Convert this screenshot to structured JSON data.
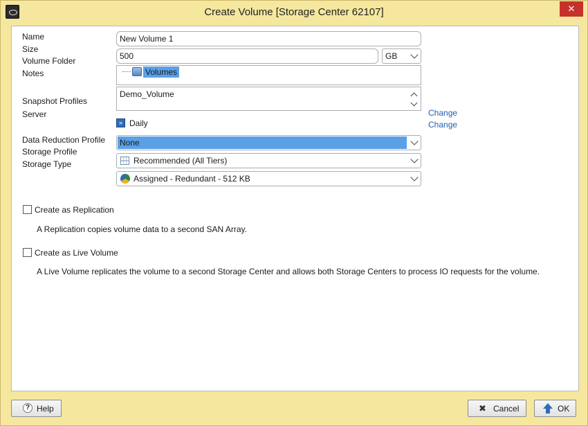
{
  "window": {
    "title": "Create Volume [Storage Center 62107]",
    "close_glyph": "✕"
  },
  "labels": {
    "name": "Name",
    "size": "Size",
    "volume_folder": "Volume Folder",
    "notes": "Notes",
    "snapshot_profiles": "Snapshot Profiles",
    "server": "Server",
    "data_reduction_profile": "Data Reduction Profile",
    "storage_profile": "Storage Profile",
    "storage_type": "Storage Type"
  },
  "fields": {
    "name_value": "New Volume 1",
    "size_value": "500",
    "size_unit": "GB",
    "volume_folder_value": "Volumes",
    "notes_value": "Demo_Volume",
    "snapshot_profile_value": "Daily",
    "data_reduction_value": "None",
    "storage_profile_value": "Recommended (All Tiers)",
    "storage_type_value": "Assigned - Redundant - 512 KB"
  },
  "links": {
    "change_snapshot": "Change",
    "change_server": "Change"
  },
  "replication": {
    "label": "Create as Replication",
    "description": "A Replication copies volume data to a second SAN Array."
  },
  "live_volume": {
    "label": "Create as Live Volume",
    "description": "A Live Volume replicates the volume to a second Storage Center and allows both Storage Centers to process IO requests for the volume."
  },
  "buttons": {
    "help": "Help",
    "cancel": "Cancel",
    "ok": "OK"
  },
  "colors": {
    "title_bar": "#f5e79e",
    "close": "#c7312b",
    "selection": "#5aa0e6",
    "link": "#2060b0"
  }
}
